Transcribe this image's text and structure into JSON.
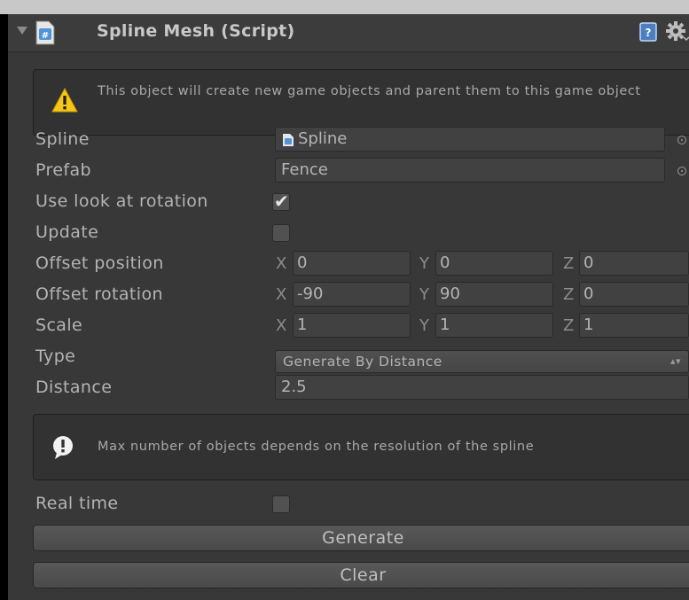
{
  "component": {
    "title": "Spline Mesh (Script)"
  },
  "info_box": {
    "text": "This object will create new game objects and parent them to this game object"
  },
  "fields": {
    "spline": {
      "label": "Spline",
      "value": "Spline"
    },
    "prefab": {
      "label": "Prefab",
      "value": "Fence"
    },
    "use_look_at_rotation": {
      "label": "Use look at rotation",
      "checked": true
    },
    "update": {
      "label": "Update",
      "checked": false
    },
    "offset_position": {
      "label": "Offset position",
      "x": "0",
      "y": "0",
      "z": "0"
    },
    "offset_rotation": {
      "label": "Offset rotation",
      "x": "-90",
      "y": "90",
      "z": "0"
    },
    "scale": {
      "label": "Scale",
      "x": "1",
      "y": "1",
      "z": "1"
    },
    "type": {
      "label": "Type",
      "value": "Generate By Distance"
    },
    "distance": {
      "label": "Distance",
      "value": "2.5"
    },
    "real_time": {
      "label": "Real time",
      "checked": false
    }
  },
  "axes": {
    "x": "X",
    "y": "Y",
    "z": "Z"
  },
  "note_box": {
    "text": "Max number of objects depends on the resolution of the spline"
  },
  "buttons": {
    "generate": "Generate",
    "clear": "Clear"
  },
  "icons": {
    "foldout": "foldout-arrow-icon",
    "script": "csharp-script-icon",
    "help": "help-book-icon",
    "settings": "gear-icon",
    "warning": "warning-icon",
    "info": "info-icon",
    "object_field": "object-picker-icon",
    "dropdown": "dropdown-arrows-icon"
  },
  "colors": {
    "panel_bg": "#383838",
    "warning": "#f5c518",
    "script_icon": "#4d96d6"
  }
}
